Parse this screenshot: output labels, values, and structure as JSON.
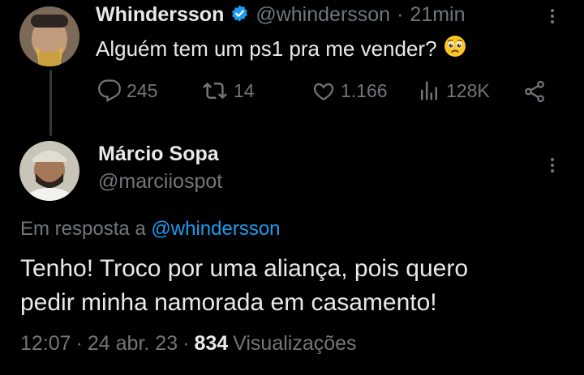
{
  "original_tweet": {
    "display_name": "Whindersson",
    "handle": "@whindersson",
    "separator": "·",
    "time_ago": "21min",
    "text": "Alguém tem um ps1 pra me vender?",
    "emoji": "pleading-face",
    "metrics": {
      "replies": "245",
      "retweets": "14",
      "likes": "1.166",
      "views": "128K"
    },
    "icons": [
      "verified-badge-icon",
      "reply-icon",
      "retweet-icon",
      "like-icon",
      "views-icon",
      "share-icon",
      "more-icon"
    ]
  },
  "reply_tweet": {
    "display_name": "Márcio Sopa",
    "handle": "@marciiospot",
    "replying_prefix": "Em resposta a",
    "replying_to": "@whindersson",
    "text_line1": "Tenho! Troco por uma aliança, pois quero",
    "text_line2": "pedir minha namorada em casamento!",
    "time": "12:07",
    "dot1": "·",
    "date": "24 abr. 23",
    "dot2": "·",
    "views_count": "834",
    "views_label": "Visualizações"
  },
  "colors": {
    "background": "#000000",
    "primary_text": "#e7e9ea",
    "secondary_text": "#71767b",
    "link": "#1d9bf0",
    "verified": "#1d9bf0"
  }
}
